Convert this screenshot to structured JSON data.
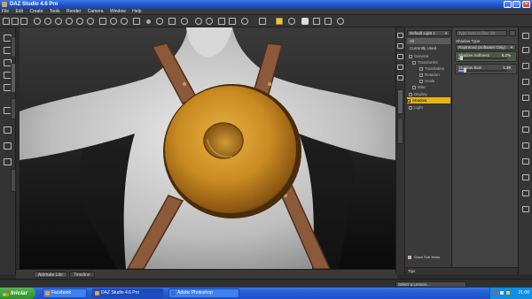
{
  "window": {
    "title": "DAZ Studio 4.6 Pro"
  },
  "menu": [
    "File",
    "Edit",
    "Create",
    "Tools",
    "Render",
    "Camera",
    "Window",
    "Help"
  ],
  "toolbar": {
    "icons": [
      "new-scene-icon",
      "open-icon",
      "save-icon",
      "pointer-icon",
      "universal-tool-icon",
      "rotate-tool-icon",
      "translate-tool-icon",
      "scale-tool-icon",
      "joint-editor-icon",
      "geometry-editor-icon",
      "node-weight-icon",
      "surface-selection-icon",
      "active-pose-icon",
      "region-navigator-icon",
      "render-settings-icon",
      "render-icon",
      "spot-render-icon",
      "camera-icon",
      "viewport-settings-icon"
    ]
  },
  "left_tabs": [
    "Smart Content",
    "Content Library",
    "Posing",
    "Shaping"
  ],
  "mid_tabs": [
    "Scene",
    "Surfaces"
  ],
  "surfaces": {
    "header_combo": "Default Light 1",
    "tabs": {
      "all": "All",
      "currently_used": "Currently Used"
    },
    "tree": [
      {
        "label": "General",
        "indent": 1
      },
      {
        "label": "Transforms",
        "indent": 2
      },
      {
        "label": "Translation",
        "indent": 3
      },
      {
        "label": "Rotation",
        "indent": 3
      },
      {
        "label": "Scale",
        "indent": 3
      },
      {
        "label": "Misc",
        "indent": 2
      },
      {
        "label": "Display",
        "indent": 1
      },
      {
        "label": "Shadow",
        "indent": 1,
        "selected": true
      },
      {
        "label": "Light",
        "indent": 1
      }
    ],
    "search_placeholder": "Type here to filter list",
    "properties": {
      "shadow_type_label": "Shadow Type",
      "shadow_type_value": "Raytraced (Software Only)",
      "shadow_softness_label": "Shadow Softness",
      "shadow_softness_value": "6.2%",
      "shadow_softness_fraction": 0.062,
      "shadow_bias_label": "Shadow Bias",
      "shadow_bias_value": "1.39",
      "shadow_bias_fraction": 0.14
    },
    "show_sub_items": "Show Sub Items",
    "footer_label": "Tips"
  },
  "viewport_bottom_tabs": [
    "Animate Lite",
    "Timeline"
  ],
  "lesson": {
    "placeholder": "Select a Lesson..."
  },
  "taskbar": {
    "start_label": "Iniciar",
    "tasks": [
      {
        "label": "Facebook",
        "icon": "browser-icon",
        "active": false
      },
      {
        "label": "DAZ Studio 4.6 Pro",
        "icon": "daz-icon",
        "active": true
      },
      {
        "label": "Adobe Photoshop",
        "icon": "photoshop-icon",
        "active": false
      }
    ],
    "clock": "21:08"
  },
  "colors": {
    "accent_selection": "#e6b312",
    "shield_gold": "#c98a22",
    "strap_brown": "#8a5a3a",
    "figure_gray": "#bdbdbd"
  }
}
